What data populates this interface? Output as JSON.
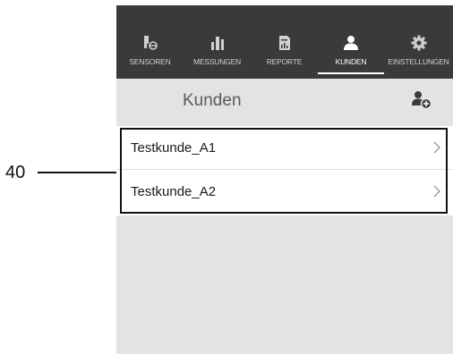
{
  "callout": {
    "number": "40"
  },
  "tabs": [
    {
      "label": "SENSOREN",
      "icon": "sensor-icon",
      "active": false
    },
    {
      "label": "MESSUNGEN",
      "icon": "bar-chart-icon",
      "active": false
    },
    {
      "label": "REPORTE",
      "icon": "report-icon",
      "active": false
    },
    {
      "label": "KUNDEN",
      "icon": "customer-icon",
      "active": true
    },
    {
      "label": "EINSTELLUNGEN",
      "icon": "gear-icon",
      "active": false
    }
  ],
  "header": {
    "title": "Kunden",
    "add_icon": "add-customer-icon"
  },
  "customers": [
    {
      "name": "Testkunde_A1"
    },
    {
      "name": "Testkunde_A2"
    }
  ],
  "colors": {
    "tabbar_bg": "#3a3a3a",
    "screen_bg": "#e3e3e3",
    "list_bg": "#ffffff",
    "active_tab": "#ffffff"
  }
}
